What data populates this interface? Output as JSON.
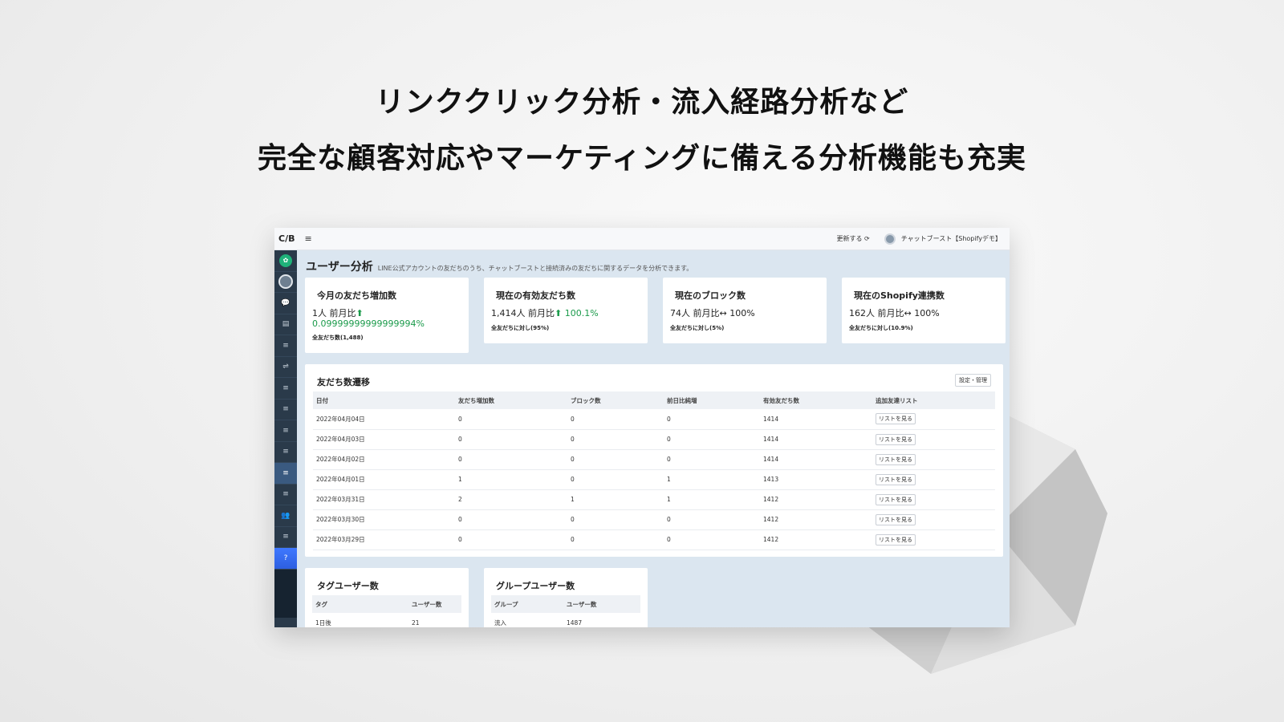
{
  "headline": {
    "line1": "リンククリック分析・流入経路分析など",
    "line2": "完全な顧客対応やマーケティングに備える分析機能も充実"
  },
  "topbar": {
    "logo": "C/B",
    "refresh": "更新する ⟳",
    "user": "チャットブースト【Shopifyデモ】"
  },
  "page": {
    "title": "ユーザー分析",
    "subtitle": "LINE公式アカウントの友だちのうち、チャットブーストと接続済みの友だちに関するデータを分析できます。"
  },
  "stats": [
    {
      "title": "今月の友だち増加数",
      "value": "1人",
      "compare": "前月比",
      "arrow": "⬆",
      "change": "0.09999999999999994%",
      "note": "全友だち数(1,488)"
    },
    {
      "title": "現在の有効友だち数",
      "value": "1,414人",
      "compare": "前月比",
      "arrow": "⬆",
      "change": "100.1%",
      "note": "全友だちに対し(95%)"
    },
    {
      "title": "現在のブロック数",
      "value": "74人",
      "compare": "前月比",
      "arrow": "↔",
      "change": "100%",
      "note": "全友だちに対し(5%)"
    },
    {
      "title": "現在のShopify連携数",
      "value": "162人",
      "compare": "前月比",
      "arrow": "↔",
      "change": "100%",
      "note": "全友だちに対し(10.9%)"
    }
  ],
  "friends_table": {
    "title": "友だち数遷移",
    "settings_label": "設定・管理",
    "columns": [
      "日付",
      "友だち増加数",
      "ブロック数",
      "前日比純増",
      "有効友だち数",
      "追加友達リスト"
    ],
    "button_label": "リストを見る",
    "rows": [
      [
        "2022年04月04日",
        "0",
        "0",
        "0",
        "1414"
      ],
      [
        "2022年04月03日",
        "0",
        "0",
        "0",
        "1414"
      ],
      [
        "2022年04月02日",
        "0",
        "0",
        "0",
        "1414"
      ],
      [
        "2022年04月01日",
        "1",
        "0",
        "1",
        "1413"
      ],
      [
        "2022年03月31日",
        "2",
        "1",
        "1",
        "1412"
      ],
      [
        "2022年03月30日",
        "0",
        "0",
        "0",
        "1412"
      ],
      [
        "2022年03月29日",
        "0",
        "0",
        "0",
        "1412"
      ]
    ]
  },
  "tag_users": {
    "title": "タグユーザー数",
    "columns": [
      "タグ",
      "ユーザー数"
    ],
    "rows": [
      [
        "1日後",
        "21"
      ]
    ]
  },
  "group_users": {
    "title": "グループユーザー数",
    "columns": [
      "グループ",
      "ユーザー数"
    ],
    "rows": [
      [
        "流入",
        "1487"
      ]
    ]
  },
  "icons": {
    "sidebar": [
      "leaf-icon",
      "avatar",
      "chat-icon",
      "document-icon",
      "list-icon",
      "usb-icon",
      "list-icon",
      "list-icon",
      "list-icon",
      "list-icon",
      "list-icon",
      "list-icon",
      "users-icon",
      "list-icon",
      "help-icon"
    ]
  }
}
